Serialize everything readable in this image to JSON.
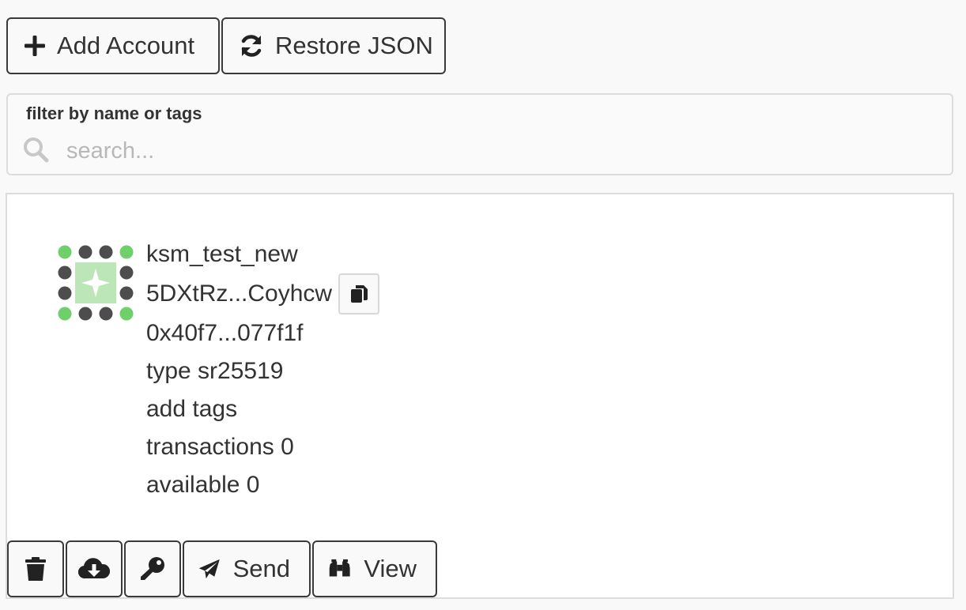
{
  "toolbar": {
    "add_account_label": "Add Account",
    "restore_json_label": "Restore JSON"
  },
  "filter": {
    "label": "filter by name or tags",
    "placeholder": "search..."
  },
  "account": {
    "name": "ksm_test_new",
    "address": "5DXtRz...Coyhcw",
    "pubkey": "0x40f7...077f1f",
    "type": "type sr25519",
    "tags": "add tags",
    "transactions": "transactions 0",
    "available": "available 0",
    "icons": {
      "identicon": "polkadot-identicon",
      "copy": "copy-icon"
    }
  },
  "actions": {
    "delete_icon": "trash-icon",
    "backup_icon": "cloud-download-icon",
    "password_icon": "key-icon",
    "send_label": "Send",
    "view_label": "View"
  },
  "colors": {
    "background": "#f9f9f9",
    "card": "#ffffff",
    "border_dark": "#3a3a3a",
    "border_light": "#dcdcdc",
    "identicon_green": "#6fcf6a",
    "identicon_dark": "#4d4d4d",
    "identicon_center": "#bde6b8"
  }
}
